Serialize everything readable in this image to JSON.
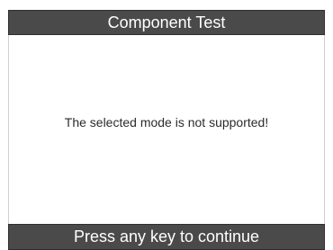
{
  "header": {
    "title": "Component Test"
  },
  "main": {
    "message": "The selected mode is not supported!"
  },
  "footer": {
    "prompt": "Press any key to continue"
  },
  "colors": {
    "bar_background": "#4a4a4a",
    "bar_text": "#ffffff",
    "content_background": "#ffffff",
    "message_text": "#2b2b2b"
  }
}
